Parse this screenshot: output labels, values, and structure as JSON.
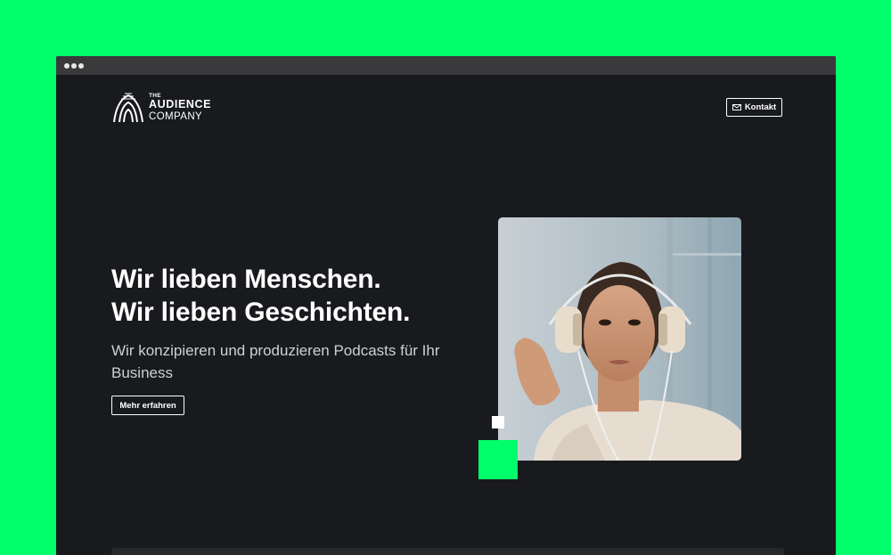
{
  "window": {
    "controls": [
      "dot",
      "dot",
      "dot"
    ]
  },
  "logo": {
    "line1": "THE",
    "line2": "AUDIENCE",
    "line3": "COMPANY"
  },
  "header": {
    "contact_label": "Kontakt",
    "contact_icon": "mail-icon"
  },
  "hero": {
    "headline_line1": "Wir lieben Menschen.",
    "headline_line2": "Wir lieben Geschichten.",
    "subtitle": "Wir konzipieren und produzieren Podcasts für Ihr Business",
    "cta_label": "Mehr erfahren"
  },
  "colors": {
    "accent": "#00ff6a",
    "page_bg": "#181a1d",
    "titlebar": "#3a3a3c"
  }
}
